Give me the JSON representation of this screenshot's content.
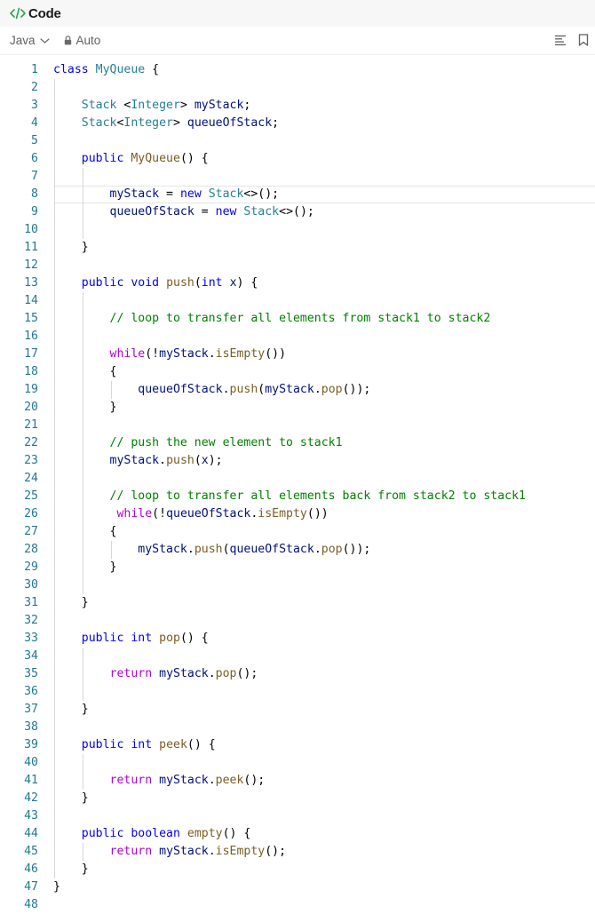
{
  "panel": {
    "title": "Code"
  },
  "toolbar": {
    "language": "Java",
    "mode": "Auto"
  },
  "icons": {
    "code": "code-brackets-icon",
    "language_dropdown": "chevron-down-icon",
    "mode_lock": "lock-icon",
    "format": "format-align-icon",
    "bookmark": "bookmark-icon"
  },
  "colors": {
    "keyword": "#0000ff",
    "control_keyword": "#af00db",
    "type": "#267f99",
    "function": "#795e26",
    "variable": "#001080",
    "comment": "#008000",
    "line_number": "#237893",
    "accent_icon": "#2da44e"
  },
  "editor": {
    "current_line": 8,
    "lines": [
      {
        "n": "1",
        "tokens": [
          [
            "kw",
            "class"
          ],
          [
            "pl",
            " "
          ],
          [
            "ty",
            "MyQueue"
          ],
          [
            "pl",
            " {"
          ]
        ]
      },
      {
        "n": "2",
        "tokens": []
      },
      {
        "n": "3",
        "tokens": [
          [
            "pl",
            "    "
          ],
          [
            "ty",
            "Stack"
          ],
          [
            "pl",
            " <"
          ],
          [
            "ty",
            "Integer"
          ],
          [
            "pl",
            "> "
          ],
          [
            "va",
            "myStack"
          ],
          [
            "pl",
            ";"
          ]
        ]
      },
      {
        "n": "4",
        "tokens": [
          [
            "pl",
            "    "
          ],
          [
            "ty",
            "Stack"
          ],
          [
            "pl",
            "<"
          ],
          [
            "ty",
            "Integer"
          ],
          [
            "pl",
            "> "
          ],
          [
            "va",
            "queueOfStack"
          ],
          [
            "pl",
            ";"
          ]
        ]
      },
      {
        "n": "5",
        "tokens": []
      },
      {
        "n": "6",
        "tokens": [
          [
            "pl",
            "    "
          ],
          [
            "kw",
            "public"
          ],
          [
            "pl",
            " "
          ],
          [
            "fn",
            "MyQueue"
          ],
          [
            "pl",
            "() {"
          ]
        ]
      },
      {
        "n": "7",
        "tokens": []
      },
      {
        "n": "8",
        "tokens": [
          [
            "pl",
            "        "
          ],
          [
            "va",
            "myStack"
          ],
          [
            "pl",
            " = "
          ],
          [
            "kw",
            "new"
          ],
          [
            "pl",
            " "
          ],
          [
            "ty",
            "Stack"
          ],
          [
            "pl",
            "<>();"
          ]
        ]
      },
      {
        "n": "9",
        "tokens": [
          [
            "pl",
            "        "
          ],
          [
            "va",
            "queueOfStack"
          ],
          [
            "pl",
            " = "
          ],
          [
            "kw",
            "new"
          ],
          [
            "pl",
            " "
          ],
          [
            "ty",
            "Stack"
          ],
          [
            "pl",
            "<>();"
          ]
        ]
      },
      {
        "n": "10",
        "tokens": []
      },
      {
        "n": "11",
        "tokens": [
          [
            "pl",
            "    }"
          ]
        ]
      },
      {
        "n": "12",
        "tokens": []
      },
      {
        "n": "13",
        "tokens": [
          [
            "pl",
            "    "
          ],
          [
            "kw",
            "public"
          ],
          [
            "pl",
            " "
          ],
          [
            "kw",
            "void"
          ],
          [
            "pl",
            " "
          ],
          [
            "fn",
            "push"
          ],
          [
            "pl",
            "("
          ],
          [
            "kw",
            "int"
          ],
          [
            "pl",
            " "
          ],
          [
            "va",
            "x"
          ],
          [
            "pl",
            ") {"
          ]
        ]
      },
      {
        "n": "14",
        "tokens": []
      },
      {
        "n": "15",
        "tokens": [
          [
            "pl",
            "        "
          ],
          [
            "cm",
            "// loop to transfer all elements from stack1 to stack2"
          ]
        ]
      },
      {
        "n": "16",
        "tokens": []
      },
      {
        "n": "17",
        "tokens": [
          [
            "pl",
            "        "
          ],
          [
            "kwp",
            "while"
          ],
          [
            "pl",
            "(!"
          ],
          [
            "va",
            "myStack"
          ],
          [
            "pl",
            "."
          ],
          [
            "fn",
            "isEmpty"
          ],
          [
            "pl",
            "())"
          ]
        ]
      },
      {
        "n": "18",
        "tokens": [
          [
            "pl",
            "        {"
          ]
        ]
      },
      {
        "n": "19",
        "tokens": [
          [
            "pl",
            "            "
          ],
          [
            "va",
            "queueOfStack"
          ],
          [
            "pl",
            "."
          ],
          [
            "fn",
            "push"
          ],
          [
            "pl",
            "("
          ],
          [
            "va",
            "myStack"
          ],
          [
            "pl",
            "."
          ],
          [
            "fn",
            "pop"
          ],
          [
            "pl",
            "());"
          ]
        ]
      },
      {
        "n": "20",
        "tokens": [
          [
            "pl",
            "        }"
          ]
        ]
      },
      {
        "n": "21",
        "tokens": []
      },
      {
        "n": "22",
        "tokens": [
          [
            "pl",
            "        "
          ],
          [
            "cm",
            "// push the new element to stack1"
          ]
        ]
      },
      {
        "n": "23",
        "tokens": [
          [
            "pl",
            "        "
          ],
          [
            "va",
            "myStack"
          ],
          [
            "pl",
            "."
          ],
          [
            "fn",
            "push"
          ],
          [
            "pl",
            "("
          ],
          [
            "va",
            "x"
          ],
          [
            "pl",
            ");"
          ]
        ]
      },
      {
        "n": "24",
        "tokens": []
      },
      {
        "n": "25",
        "tokens": [
          [
            "pl",
            "        "
          ],
          [
            "cm",
            "// loop to transfer all elements back from stack2 to stack1"
          ]
        ]
      },
      {
        "n": "26",
        "tokens": [
          [
            "pl",
            "         "
          ],
          [
            "kwp",
            "while"
          ],
          [
            "pl",
            "(!"
          ],
          [
            "va",
            "queueOfStack"
          ],
          [
            "pl",
            "."
          ],
          [
            "fn",
            "isEmpty"
          ],
          [
            "pl",
            "())"
          ]
        ]
      },
      {
        "n": "27",
        "tokens": [
          [
            "pl",
            "        {"
          ]
        ]
      },
      {
        "n": "28",
        "tokens": [
          [
            "pl",
            "            "
          ],
          [
            "va",
            "myStack"
          ],
          [
            "pl",
            "."
          ],
          [
            "fn",
            "push"
          ],
          [
            "pl",
            "("
          ],
          [
            "va",
            "queueOfStack"
          ],
          [
            "pl",
            "."
          ],
          [
            "fn",
            "pop"
          ],
          [
            "pl",
            "());"
          ]
        ]
      },
      {
        "n": "29",
        "tokens": [
          [
            "pl",
            "        }"
          ]
        ]
      },
      {
        "n": "30",
        "tokens": []
      },
      {
        "n": "31",
        "tokens": [
          [
            "pl",
            "    }"
          ]
        ]
      },
      {
        "n": "32",
        "tokens": []
      },
      {
        "n": "33",
        "tokens": [
          [
            "pl",
            "    "
          ],
          [
            "kw",
            "public"
          ],
          [
            "pl",
            " "
          ],
          [
            "kw",
            "int"
          ],
          [
            "pl",
            " "
          ],
          [
            "fn",
            "pop"
          ],
          [
            "pl",
            "() {"
          ]
        ]
      },
      {
        "n": "34",
        "tokens": []
      },
      {
        "n": "35",
        "tokens": [
          [
            "pl",
            "        "
          ],
          [
            "kwp",
            "return"
          ],
          [
            "pl",
            " "
          ],
          [
            "va",
            "myStack"
          ],
          [
            "pl",
            "."
          ],
          [
            "fn",
            "pop"
          ],
          [
            "pl",
            "();"
          ]
        ]
      },
      {
        "n": "36",
        "tokens": []
      },
      {
        "n": "37",
        "tokens": [
          [
            "pl",
            "    }"
          ]
        ]
      },
      {
        "n": "38",
        "tokens": []
      },
      {
        "n": "39",
        "tokens": [
          [
            "pl",
            "    "
          ],
          [
            "kw",
            "public"
          ],
          [
            "pl",
            " "
          ],
          [
            "kw",
            "int"
          ],
          [
            "pl",
            " "
          ],
          [
            "fn",
            "peek"
          ],
          [
            "pl",
            "() {"
          ]
        ]
      },
      {
        "n": "40",
        "tokens": []
      },
      {
        "n": "41",
        "tokens": [
          [
            "pl",
            "        "
          ],
          [
            "kwp",
            "return"
          ],
          [
            "pl",
            " "
          ],
          [
            "va",
            "myStack"
          ],
          [
            "pl",
            "."
          ],
          [
            "fn",
            "peek"
          ],
          [
            "pl",
            "();"
          ]
        ]
      },
      {
        "n": "42",
        "tokens": [
          [
            "pl",
            "    }"
          ]
        ]
      },
      {
        "n": "43",
        "tokens": []
      },
      {
        "n": "44",
        "tokens": [
          [
            "pl",
            "    "
          ],
          [
            "kw",
            "public"
          ],
          [
            "pl",
            " "
          ],
          [
            "kw",
            "boolean"
          ],
          [
            "pl",
            " "
          ],
          [
            "fn",
            "empty"
          ],
          [
            "pl",
            "() {"
          ]
        ]
      },
      {
        "n": "45",
        "tokens": [
          [
            "pl",
            "        "
          ],
          [
            "kwp",
            "return"
          ],
          [
            "pl",
            " "
          ],
          [
            "va",
            "myStack"
          ],
          [
            "pl",
            "."
          ],
          [
            "fn",
            "isEmpty"
          ],
          [
            "pl",
            "();"
          ]
        ]
      },
      {
        "n": "46",
        "tokens": [
          [
            "pl",
            "    }"
          ]
        ]
      },
      {
        "n": "47",
        "tokens": [
          [
            "pl",
            "}"
          ]
        ]
      },
      {
        "n": "48",
        "tokens": []
      }
    ]
  }
}
